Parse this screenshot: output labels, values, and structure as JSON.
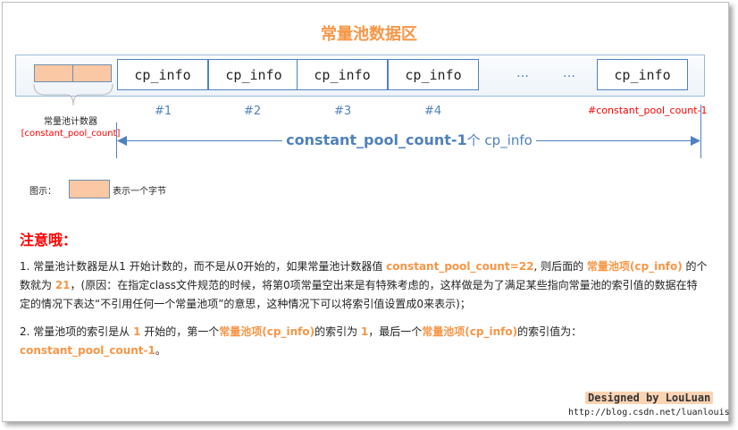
{
  "title": "常量池数据区",
  "cells": [
    "cp_info",
    "cp_info",
    "cp_info",
    "cp_info",
    "cp_info"
  ],
  "ellipsis": [
    "…",
    "…"
  ],
  "indices": [
    "#1",
    "#2",
    "#3",
    "#4",
    "#constant_pool_count-1"
  ],
  "counter": {
    "label": "常量池计数器",
    "name": "[constant_pool_count]"
  },
  "span_label": {
    "main": "constant_pool_count-1",
    "suffix": "个 cp_info"
  },
  "legend": {
    "prefix": "图示：",
    "desc": "表示一个字节"
  },
  "notice": "注意哦：",
  "note1": {
    "p1": "1.   常量池计数器是从1 开始计数的，而不是从0开始的，如果常量池计数器值 ",
    "h1": "constant_pool_count=22",
    "p2": ", 则后面的 ",
    "h2": "常量池项",
    "h3": "(cp_info)",
    "p3": " 的个数就为 ",
    "h4": "21",
    "p4": "，(原因：在指定class文件规范的时候，将第0项常量空出来是有特殊考虑的，这样做是为了满足某些指向常量池的索引值的数据在特定的情况下表达“不引用任何一个常量池项”的意思，这种情况下可以将索引值设置成0来表示)；"
  },
  "note2": {
    "p1": "2.    常量池项的索引是从 ",
    "h1": "1",
    "p2": " 开始的，第一个",
    "h2": "常量池项(cp_info)",
    "p3": "的索引为 ",
    "h3": "1",
    "p4": "，最后一个",
    "h4": "常量池项(cp_info)",
    "p5": "的索引值为：",
    "h5": "constant_pool_count-1",
    "p6": "。"
  },
  "signature": "Designed by LouLuan",
  "url": "http://blog.csdn.net/luanlouis",
  "colors": {
    "accent": "#f79646",
    "blue": "#4f81bd",
    "red": "#ff0000",
    "byte_fill": "#fac8a4"
  }
}
